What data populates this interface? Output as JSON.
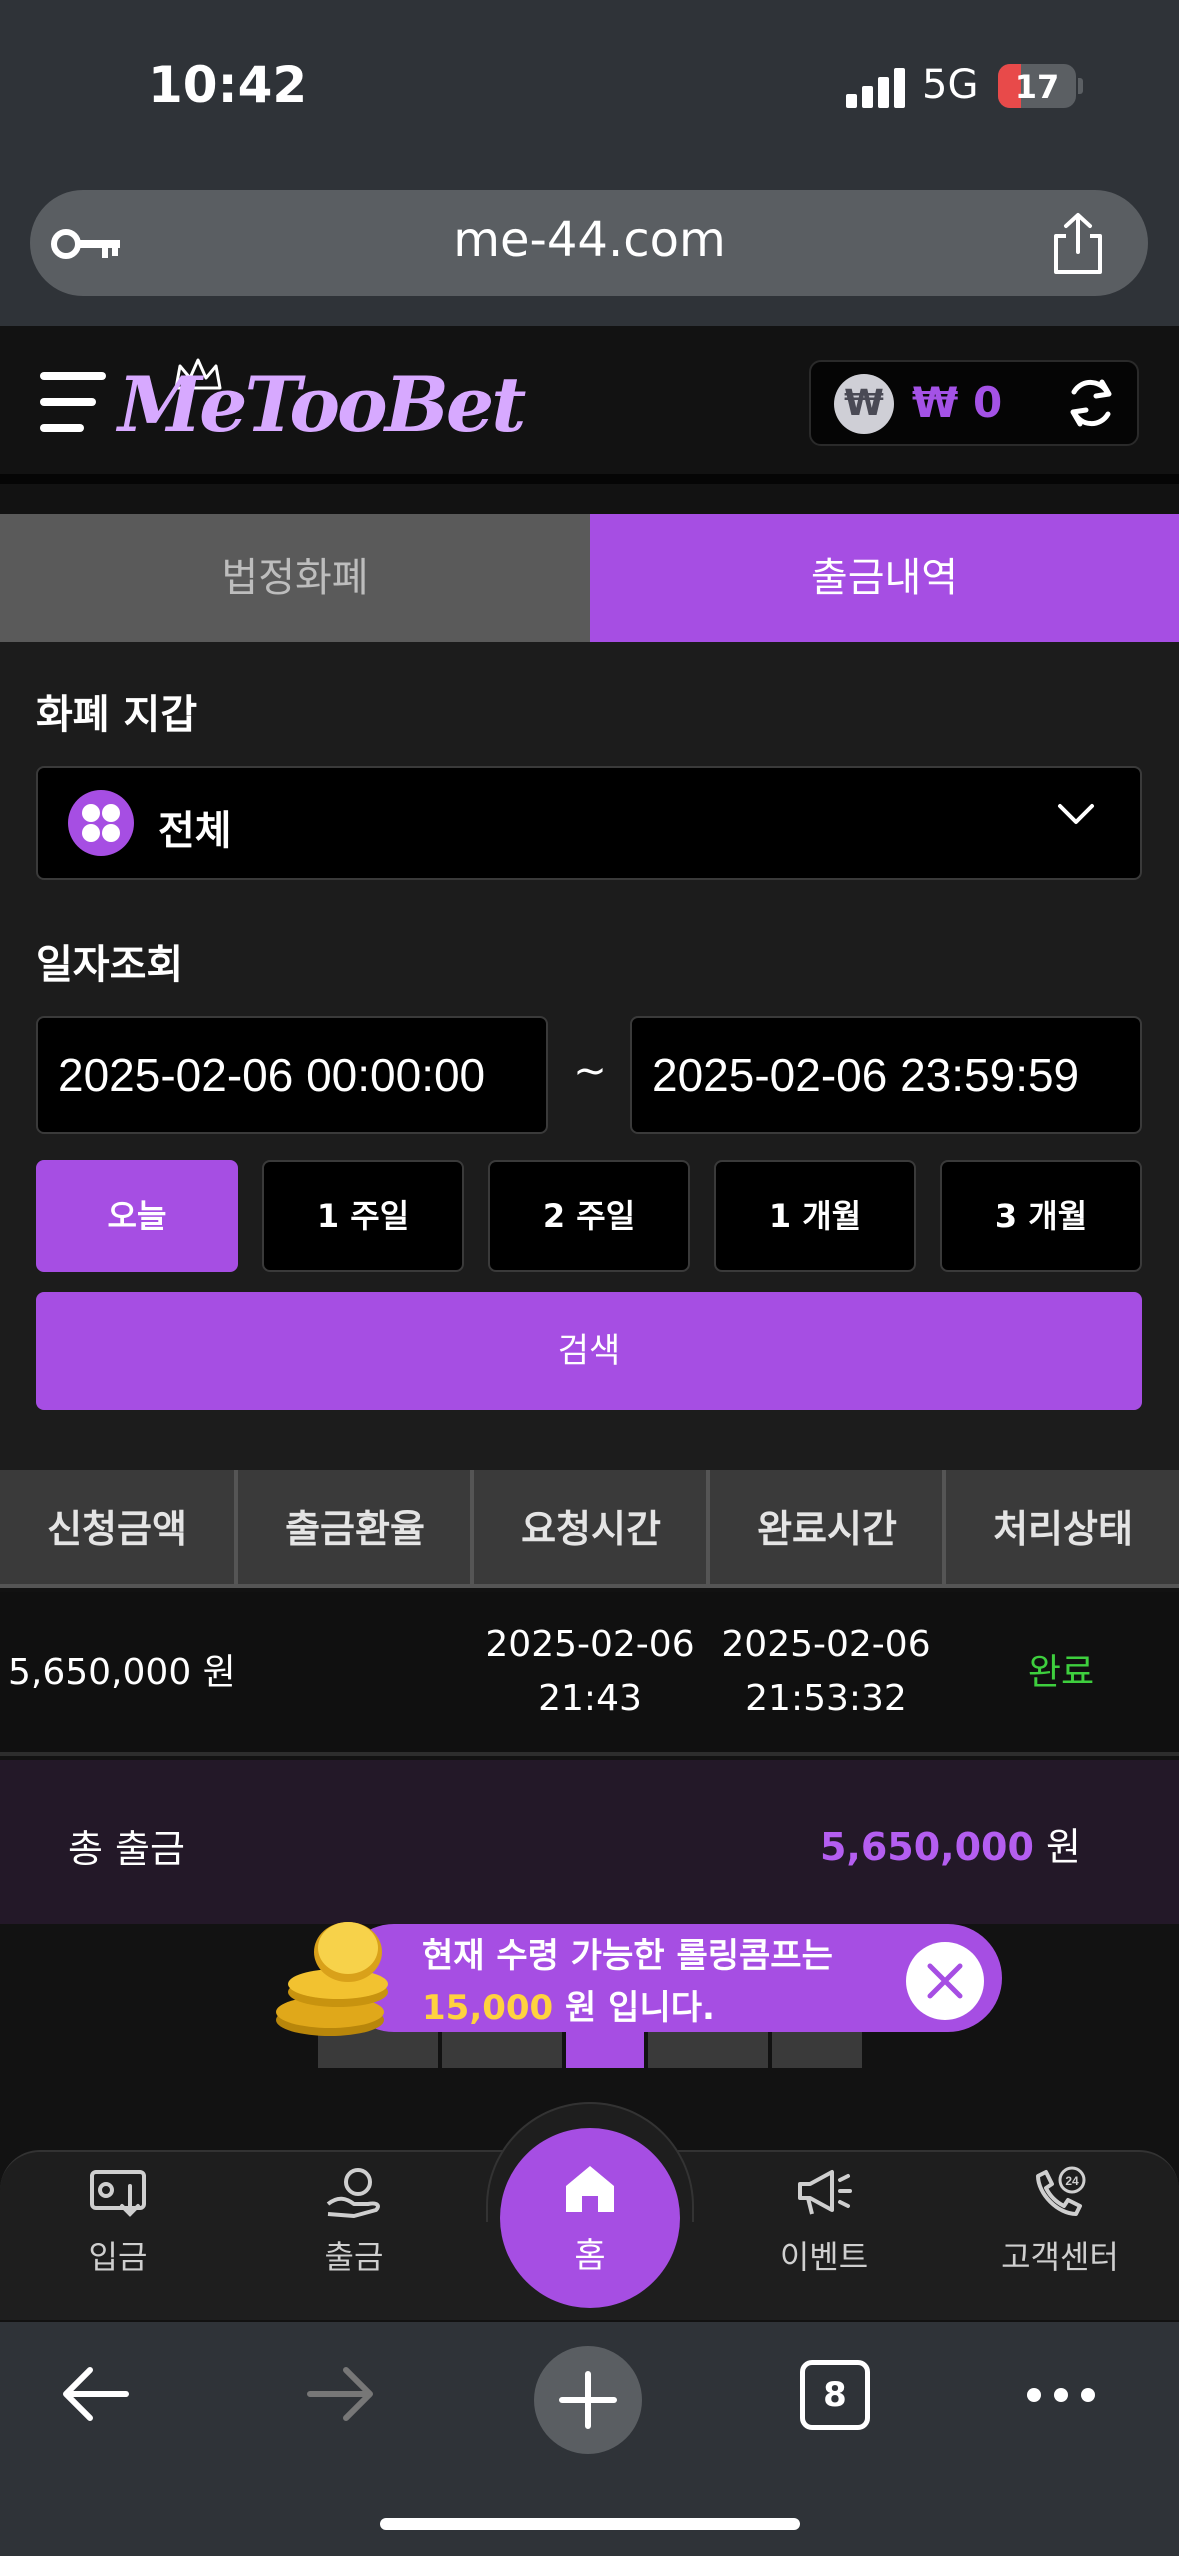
{
  "status_bar": {
    "time": "10:42",
    "network": "5G",
    "battery": "17"
  },
  "browser": {
    "url": "me-44.com",
    "tabs_count": "8"
  },
  "header": {
    "logo": "MeTooBet",
    "wallet_amount": "₩ 0",
    "won_symbol": "₩"
  },
  "tabs": [
    {
      "label": "법정화폐",
      "active": false
    },
    {
      "label": "출금내역",
      "active": true
    }
  ],
  "wallet_section": {
    "label": "화폐 지갑",
    "selected": "전체"
  },
  "date_section": {
    "label": "일자조회",
    "start": "2025-02-06 00:00:00",
    "end": "2025-02-06 23:59:59",
    "separator": "~"
  },
  "quick_ranges": [
    "오늘",
    "1 주일",
    "2 주일",
    "1 개월",
    "3 개월"
  ],
  "search_label": "검색",
  "table": {
    "headers": [
      "신청금액",
      "출금환율",
      "요청시간",
      "완료시간",
      "처리상태"
    ],
    "rows": [
      {
        "amount": "5,650,000 원",
        "rate": "",
        "request_date": "2025-02-06",
        "request_time": "21:43",
        "complete_date": "2025-02-06",
        "complete_time": "21:53:32",
        "status": "완료"
      }
    ]
  },
  "total": {
    "label": "총 출금",
    "amount": "5,650,000",
    "unit": "원"
  },
  "promo": {
    "line1": "현재 수령 가능한 롤링콤프는",
    "amount": "15,000",
    "line2_suffix": "원 입니다."
  },
  "bottom_nav": {
    "deposit": "입금",
    "withdraw": "출금",
    "home": "홈",
    "event": "이벤트",
    "support": "고객센터"
  },
  "colors": {
    "accent": "#a64ee3",
    "done": "#3ecf3e",
    "promo_highlight": "#ffd23f"
  }
}
